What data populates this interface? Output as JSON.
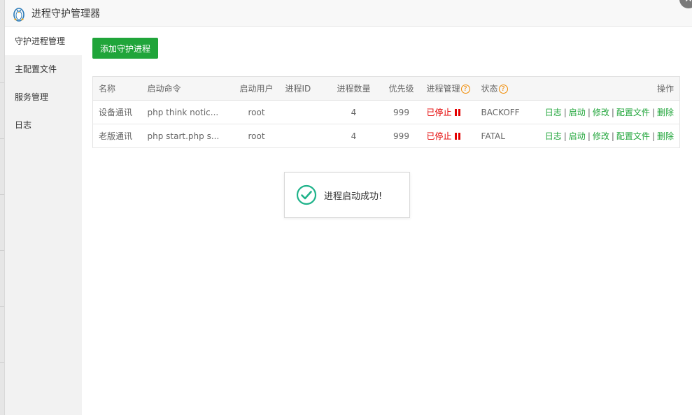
{
  "window": {
    "title": "进程守护管理器"
  },
  "sidebar": {
    "items": [
      {
        "label": "守护进程管理",
        "active": true
      },
      {
        "label": "主配置文件",
        "active": false
      },
      {
        "label": "服务管理",
        "active": false
      },
      {
        "label": "日志",
        "active": false
      }
    ]
  },
  "toolbar": {
    "add_label": "添加守护进程"
  },
  "table": {
    "headers": {
      "name": "名称",
      "command": "启动命令",
      "user": "启动用户",
      "pid": "进程ID",
      "count": "进程数量",
      "priority": "优先级",
      "manage": "进程管理",
      "status": "状态",
      "ops": "操作"
    },
    "help_glyph": "?",
    "rows": [
      {
        "name": "设备通讯",
        "command": "php think notic...",
        "user": "root",
        "pid": "",
        "count": "4",
        "priority": "999",
        "manage": "已停止",
        "status": "BACKOFF"
      },
      {
        "name": "老版通讯",
        "command": "php start.php s...",
        "user": "root",
        "pid": "",
        "count": "4",
        "priority": "999",
        "manage": "已停止",
        "status": "FATAL"
      }
    ],
    "ops": {
      "log": "日志",
      "start": "启动",
      "edit": "修改",
      "config": "配置文件",
      "delete": "删除",
      "sep": "|"
    }
  },
  "toast": {
    "message": "进程启动成功!"
  },
  "colors": {
    "accent": "#20a53a",
    "danger": "#e40000",
    "help": "#f08a00"
  }
}
